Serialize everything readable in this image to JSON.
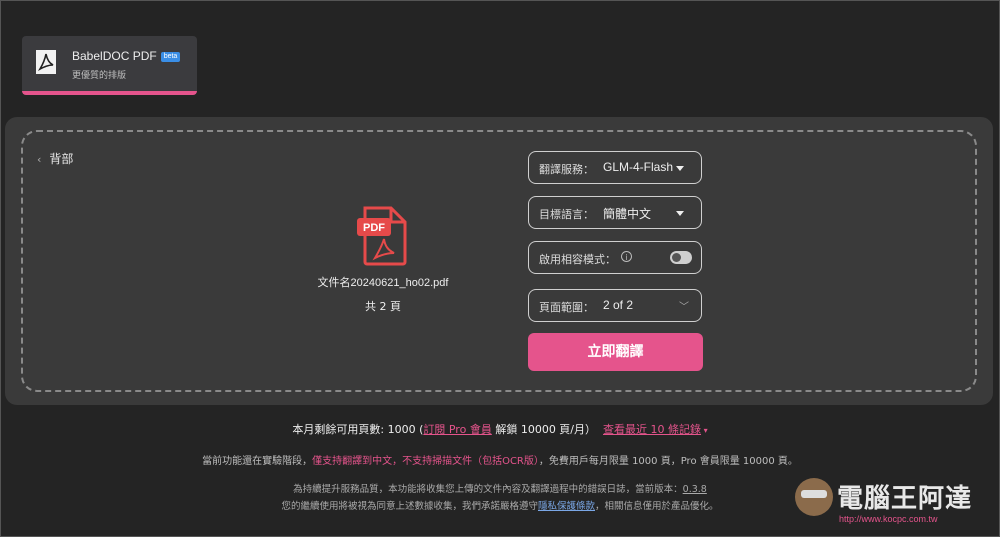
{
  "tab": {
    "title": "BabelDOC PDF",
    "badge": "beta",
    "subtitle": "更優質的排版",
    "icon": "pdf-acrobat-icon"
  },
  "back": {
    "label": "背部"
  },
  "file": {
    "icon": "pdf-file-icon",
    "icon_text": "PDF",
    "name": "文件名20240621_ho02.pdf",
    "pages": "共 2 頁"
  },
  "settings": {
    "service": {
      "label": "翻譯服務：",
      "value": "GLM-4-Flash"
    },
    "language": {
      "label": "目標語言：",
      "value": "簡體中文"
    },
    "compat": {
      "label": "啟用相容模式：",
      "enabled": false
    },
    "range": {
      "label": "頁面範圍：",
      "value": "2 of 2"
    }
  },
  "translate_button": "立即翻譯",
  "quota": {
    "prefix": "本月剩餘可用頁數: 1000 (",
    "subscribe": "訂閱 Pro 會員",
    "unlock": " 解鎖 10000 頁/月）",
    "history": "查看最近 10 條記錄"
  },
  "notice": {
    "a": "當前功能還在實驗階段，",
    "b": "僅支持翻譯到中文，不支持掃描文件（包括OCR版）",
    "c": "，免費用戶每月限量 1000 頁，Pro 會員限量 10000 頁。"
  },
  "privacy": {
    "line1a": "為持續提升服務品質，本功能將收集您上傳的文件內容及翻譯過程中的錯誤日誌，當前版本：",
    "version": "0.3.8",
    "line2a": "您的繼續使用將被視為同意上述數據收集，我們承諾嚴格遵守",
    "policy": "隱私保護條款",
    "line2b": "，相關信息僅用於產品優化。"
  },
  "watermark": {
    "text": "電腦王阿達",
    "url": "http://www.kocpc.com.tw"
  },
  "colors": {
    "accent": "#e5548c",
    "background": "#242424",
    "panel": "#3a3a3a"
  }
}
